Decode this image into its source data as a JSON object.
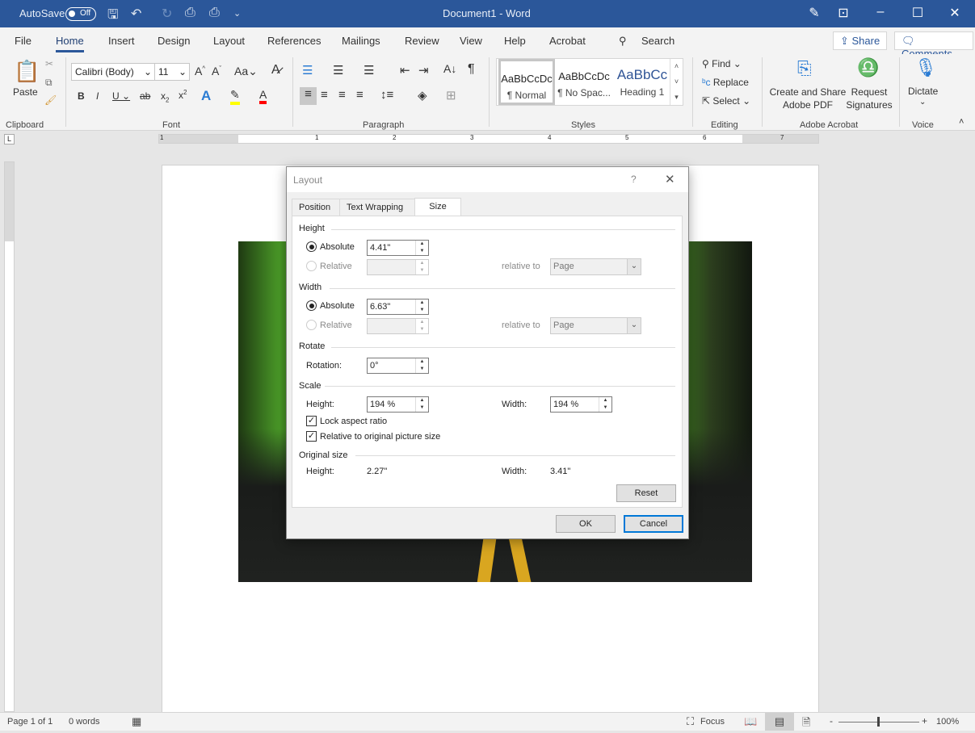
{
  "titlebar": {
    "autosave_label": "AutoSave",
    "autosave_state": "Off",
    "title": "Document1  -  Word"
  },
  "tabs": [
    {
      "label": "File"
    },
    {
      "label": "Home",
      "active": true
    },
    {
      "label": "Insert"
    },
    {
      "label": "Design"
    },
    {
      "label": "Layout"
    },
    {
      "label": "References"
    },
    {
      "label": "Mailings"
    },
    {
      "label": "Review"
    },
    {
      "label": "View"
    },
    {
      "label": "Help"
    },
    {
      "label": "Acrobat"
    }
  ],
  "search_label": "Search",
  "share_label": "Share",
  "comments_label": "Comments",
  "ribbon": {
    "clipboard": {
      "paste": "Paste",
      "group": "Clipboard"
    },
    "font": {
      "name": "Calibri (Body)",
      "size": "11",
      "group": "Font",
      "highlight_color": "#ffff00",
      "font_color": "#ff0000"
    },
    "paragraph": {
      "group": "Paragraph"
    },
    "styles": {
      "group": "Styles",
      "items": [
        {
          "sample": "AaBbCcDc",
          "name": "¶ Normal"
        },
        {
          "sample": "AaBbCcDc",
          "name": "¶ No Spac..."
        },
        {
          "sample": "AaBbCc",
          "name": "Heading 1"
        }
      ]
    },
    "editing": {
      "group": "Editing",
      "find": "Find",
      "replace": "Replace",
      "select": "Select"
    },
    "acrobat": {
      "group": "Adobe Acrobat",
      "create": "Create and Share Adobe PDF",
      "request": "Request Signatures"
    },
    "voice": {
      "group": "Voice",
      "dictate": "Dictate"
    }
  },
  "ruler": {
    "numbers": [
      "1",
      "1",
      "2",
      "3",
      "4",
      "5",
      "6",
      "7"
    ]
  },
  "dialog": {
    "title": "Layout",
    "help": "?",
    "tabs": [
      "Position",
      "Text Wrapping",
      "Size"
    ],
    "active_tab": "Size",
    "height": {
      "label": "Height",
      "absolute_label": "Absolute",
      "absolute_value": "4.41\"",
      "relative_label": "Relative",
      "relative_value": "",
      "relative_to_label": "relative to",
      "relative_to_value": "Page",
      "mode": "absolute"
    },
    "width": {
      "label": "Width",
      "absolute_label": "Absolute",
      "absolute_value": "6.63\"",
      "relative_label": "Relative",
      "relative_value": "",
      "relative_to_label": "relative to",
      "relative_to_value": "Page",
      "mode": "absolute"
    },
    "rotate": {
      "label": "Rotate",
      "rotation_label": "Rotation:",
      "rotation_value": "0°"
    },
    "scale": {
      "label": "Scale",
      "height_label": "Height:",
      "height_value": "194 %",
      "width_label": "Width:",
      "width_value": "194 %",
      "lock_aspect": "Lock aspect ratio",
      "lock_checked": true,
      "relative_original": "Relative to original picture size",
      "relative_checked": true
    },
    "original": {
      "label": "Original size",
      "height_label": "Height:",
      "height_value": "2.27\"",
      "width_label": "Width:",
      "width_value": "3.41\""
    },
    "reset": "Reset",
    "ok": "OK",
    "cancel": "Cancel"
  },
  "status": {
    "page": "Page 1 of 1",
    "words": "0 words",
    "focus": "Focus",
    "zoom": "100%",
    "zoom_percent": 100
  }
}
